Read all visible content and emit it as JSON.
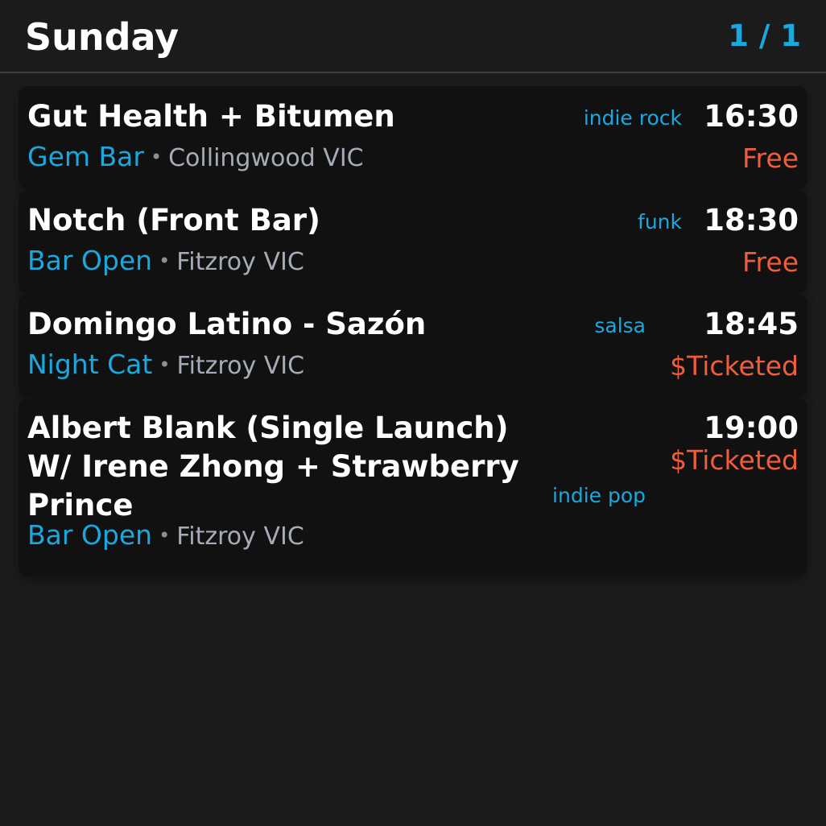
{
  "header": {
    "day": "Sunday",
    "page": "1 / 1"
  },
  "events": [
    {
      "title": "Gut Health + Bitumen",
      "genre": "indie rock",
      "time": "16:30",
      "venue": "Gem Bar",
      "separator": "•",
      "location": "Collingwood VIC",
      "price": "Free"
    },
    {
      "title": "Notch (Front Bar)",
      "genre": "funk",
      "time": "18:30",
      "venue": "Bar Open",
      "separator": "•",
      "location": "Fitzroy VIC",
      "price": "Free"
    },
    {
      "title": "Domingo Latino - Sazón",
      "genre": "salsa",
      "time": "18:45",
      "venue": "Night Cat",
      "separator": "•",
      "location": "Fitzroy VIC",
      "price": "$Ticketed"
    },
    {
      "title": "Albert Blank (Single Launch) W/ Irene Zhong + Strawberry Prince",
      "genre": "indie pop",
      "time": "19:00",
      "venue": "Bar Open",
      "separator": "•",
      "location": "Fitzroy VIC",
      "price": "$Ticketed"
    }
  ],
  "colors": {
    "background": "#1b1b1b",
    "card": "#111111",
    "accent": "#1aa8df",
    "price": "#f15d3a",
    "location": "#a6acb7",
    "divider": "#3a3d44"
  }
}
